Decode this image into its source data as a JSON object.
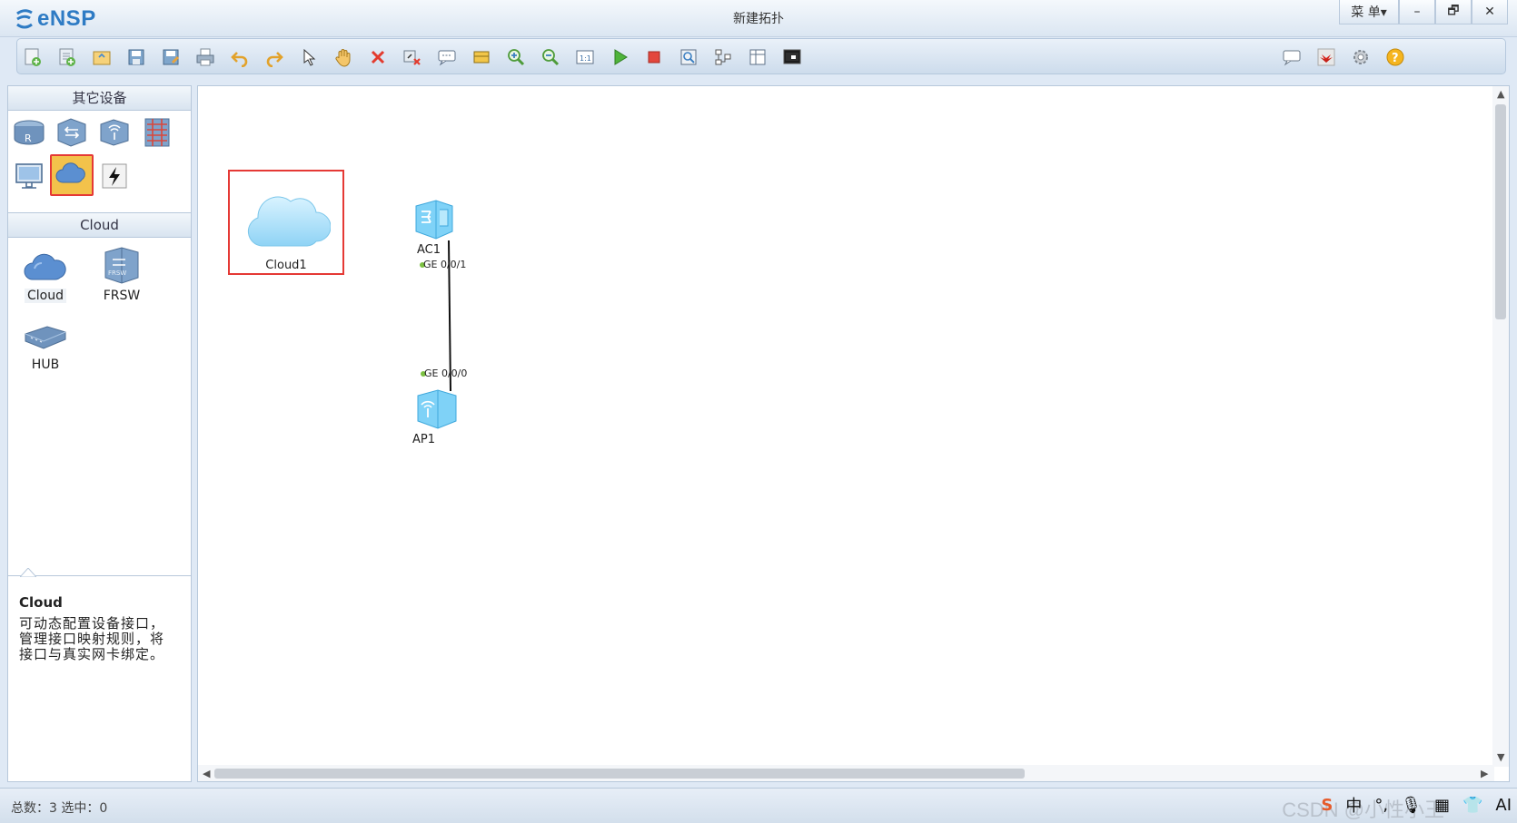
{
  "app": {
    "name": "eNSP",
    "window_title": "新建拓扑"
  },
  "window_controls": {
    "menu_label": "菜 单▾",
    "minimize": "–",
    "restore": "🗗",
    "close": "✕"
  },
  "toolbar": {
    "left_icons": [
      "new-topology-icon",
      "new-lab-icon",
      "open-icon",
      "save-icon",
      "save-as-icon",
      "print-icon",
      "undo-icon",
      "redo-icon",
      "select-pointer-icon",
      "pan-hand-icon",
      "delete-icon",
      "delete-link-icon",
      "text-annotation-icon",
      "rectangle-icon",
      "zoom-in-icon",
      "zoom-out-icon",
      "fit-view-icon",
      "start-device-icon",
      "stop-device-icon",
      "capture-icon",
      "topology-icon",
      "grid-icon",
      "console-icon"
    ],
    "right_icons": [
      "feedback-icon",
      "huawei-icon",
      "settings-icon",
      "help-icon"
    ]
  },
  "sidebar": {
    "category_header": "其它设备",
    "categories": [
      "router-icon",
      "switch-icon",
      "wlan-icon",
      "firewall-icon",
      "terminal-icon",
      "cloud-category-icon",
      "other-devices-icon"
    ],
    "selected_category": "cloud-category-icon",
    "device_header": "Cloud",
    "devices": [
      {
        "label": "Cloud",
        "icon": "cloud-icon"
      },
      {
        "label": "FRSW",
        "icon": "frsw-icon"
      },
      {
        "label": "HUB",
        "icon": "hub-icon"
      }
    ],
    "description": {
      "title": "Cloud",
      "text": "可动态配置设备接口，管理接口映射规则，将接口与真实网卡绑定。"
    }
  },
  "canvas": {
    "nodes": [
      {
        "label": "Cloud1",
        "icon": "cloud-icon"
      },
      {
        "label": "AC1",
        "icon": "ac-icon"
      },
      {
        "label": "AP1",
        "icon": "ap-icon"
      }
    ],
    "links": [
      {
        "from": "AC1",
        "from_port": "GE 0/0/1",
        "to": "AP1",
        "to_port": "GE 0/0/0"
      }
    ]
  },
  "status": {
    "text": "总数：3  选中：0"
  },
  "ime": {
    "items": [
      "中",
      "°,",
      "🎙",
      "▦",
      "👕",
      "AI"
    ]
  },
  "watermark": "CSDN @小性小王",
  "colors": {
    "accent": "#2e7bc4",
    "selection": "#e53935",
    "port": "#7cc142"
  }
}
